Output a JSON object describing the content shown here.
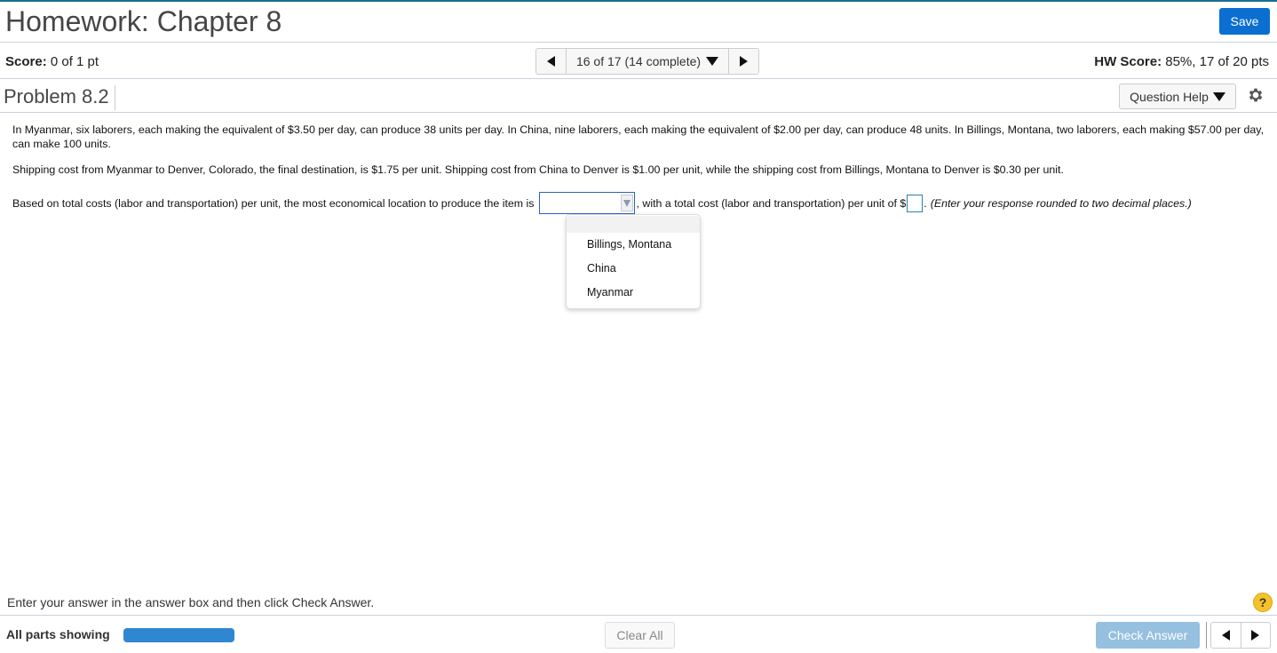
{
  "header": {
    "title": "Homework: Chapter 8",
    "save_label": "Save"
  },
  "scorebar": {
    "score_label": "Score:",
    "score_value": " 0 of 1 pt",
    "nav_label": "16 of 17 (14 complete)",
    "hw_score_label": "HW Score:",
    "hw_score_value": " 85%, 17 of 20 pts"
  },
  "problem": {
    "title": "Problem 8.2",
    "question_help_label": "Question Help"
  },
  "content": {
    "paragraph1": "In Myanmar, six laborers, each making the equivalent of $3.50 per day, can produce 38 units per day. In China, nine laborers, each making the equivalent of $2.00 per day, can produce 48 units. In Billings, Montana, two laborers, each making $57.00 per day, can make 100 units.",
    "paragraph2": "Shipping cost from Myanmar to Denver, Colorado, the final destination, is $1.75 per unit. Shipping cost from China to Denver is $1.00 per unit, while the shipping cost from Billings, Montana to Denver is $0.30 per unit.",
    "line3_prefix": "Based on total costs (labor and transportation) per unit, the most economical location to produce the item is",
    "line3_middle": ", with a total cost (labor and transportation) per unit of $",
    "line3_suffix": ".",
    "hint": "(Enter your response rounded to two decimal places.)",
    "location_select_value": "",
    "cost_input_value": ""
  },
  "dropdown": {
    "options": [
      "Billings, Montana",
      "China",
      "Myanmar"
    ]
  },
  "footer": {
    "instruction": "Enter your answer in the answer box and then click Check Answer.",
    "help_symbol": "?",
    "all_parts_label": "All parts showing",
    "progress_fraction": 1.0,
    "clear_all_label": "Clear All",
    "check_answer_label": "Check Answer"
  },
  "colors": {
    "save_button": "#0a6fd1",
    "progress": "#2f86d1",
    "check_answer_disabled": "#95c0e0",
    "help_badge": "#f4c32b"
  }
}
